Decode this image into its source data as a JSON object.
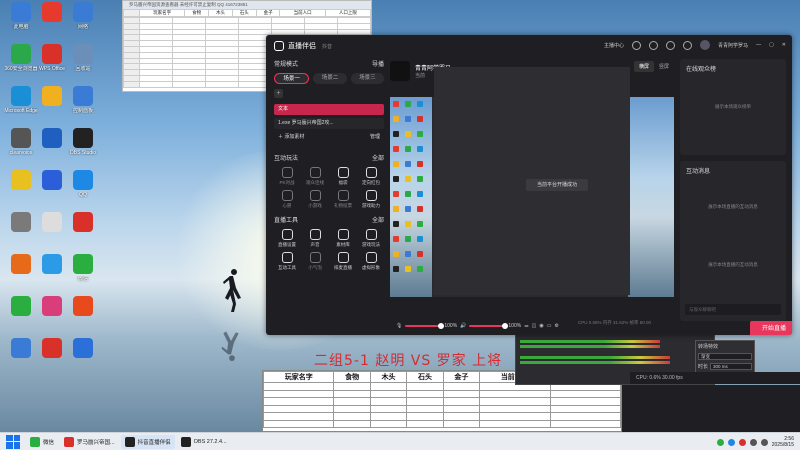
{
  "desktop": {
    "icons": [
      {
        "label": "此电脑",
        "color": "#3a7bd5"
      },
      {
        "label": "",
        "color": "#e63a2e"
      },
      {
        "label": "网络",
        "color": "#3a7bd5"
      },
      {
        "label": "360安全浏览器",
        "color": "#2aa84a"
      },
      {
        "label": "WPS Office",
        "color": "#d9302a"
      },
      {
        "label": "回收站",
        "color": "#6b8fb8"
      },
      {
        "label": "Microsoft Edge",
        "color": "#1b8fd6"
      },
      {
        "label": "",
        "color": "#f0b020"
      },
      {
        "label": "控制面板",
        "color": "#3a7bd5"
      },
      {
        "label": "clearvoice",
        "color": "#555"
      },
      {
        "label": "",
        "color": "#1f5fbf"
      },
      {
        "label": "OBS Studio",
        "color": "#222"
      },
      {
        "label": "",
        "color": "#e8c020"
      },
      {
        "label": "",
        "color": "#2b5fd9"
      },
      {
        "label": "QQ",
        "color": "#1e88e5"
      },
      {
        "label": "",
        "color": "#7a7a7a"
      },
      {
        "label": "",
        "color": "#ddd"
      },
      {
        "label": "",
        "color": "#d9302a"
      },
      {
        "label": "",
        "color": "#e66a1a"
      },
      {
        "label": "",
        "color": "#2b9be8"
      },
      {
        "label": "微信",
        "color": "#2aae3f"
      },
      {
        "label": "",
        "color": "#2aae3f"
      },
      {
        "label": "",
        "color": "#d93d7a"
      },
      {
        "label": "",
        "color": "#e8491d"
      },
      {
        "label": "",
        "color": "#3a7bd5"
      },
      {
        "label": "",
        "color": "#d9302a"
      },
      {
        "label": "",
        "color": "#2b6fd9"
      }
    ]
  },
  "small_sheet": {
    "title": "罗马蜃兴帝国资源查看器 未经许可禁止复制 QQ 416723881",
    "headers": [
      "玩家名字",
      "食物",
      "木头",
      "石头",
      "金子",
      "当前人口",
      "人口上限"
    ]
  },
  "big_sheet": {
    "headers": [
      "玩家名字",
      "食物",
      "木头",
      "石头",
      "金子",
      "当前人口",
      "人口上限"
    ]
  },
  "overlay_red_text": "二组5-1 赵明 VS 罗家 上将",
  "app": {
    "title": "直播伴侣",
    "subtitle": "抖音",
    "topbar": {
      "theme_center": "主播中心",
      "username": "青青阿学罗马"
    },
    "left": {
      "mode_label": "常规模式",
      "guide_label": "导播",
      "scenes": [
        "场景一",
        "场景二",
        "场景三"
      ],
      "sources": [
        {
          "label": "文本",
          "selected": true
        },
        {
          "label": "1.exe 罗马蜃兴帝国2攻...",
          "selected": false
        }
      ],
      "add_material": "添加素材",
      "manage": "管理",
      "interact_title": "互动玩法",
      "interact_more": "全部",
      "interact_tools": [
        {
          "label": "PK对战",
          "on": false
        },
        {
          "label": "观众连线",
          "on": false
        },
        {
          "label": "福袋",
          "on": true
        },
        {
          "label": "定向红包",
          "on": true
        },
        {
          "label": "心愿",
          "on": false
        },
        {
          "label": "小游戏",
          "on": false
        },
        {
          "label": "礼物投票",
          "on": false
        },
        {
          "label": "游戏助力",
          "on": true
        }
      ],
      "live_tools_title": "直播工具",
      "live_tools_more": "全部",
      "live_tools": [
        {
          "label": "直播设置",
          "on": true
        },
        {
          "label": "声音",
          "on": true
        },
        {
          "label": "素材库",
          "on": true
        },
        {
          "label": "游戏玩法",
          "on": true
        },
        {
          "label": "互动工具",
          "on": true
        },
        {
          "label": "小气泡",
          "on": false
        },
        {
          "label": "排麦直播",
          "on": true
        },
        {
          "label": "虚拟形象",
          "on": true
        }
      ]
    },
    "center": {
      "streamer_name": "青青阿学罗马",
      "streamer_sub": "当前",
      "mode_tabs": [
        "横屏",
        "竖屏"
      ],
      "toast": "当前平台开播成功",
      "mic_level": "100%",
      "speaker_level": "100%",
      "go_live": "开始直播",
      "status": "CPU 0.65%   内存 31.62%   帧率 60.00"
    },
    "right": {
      "viewers_title": "在线观众榜",
      "viewers_empty": "展示本场观众榜单",
      "activity_title": "互动消息",
      "activity_empty": "展示本场直播的互动消息",
      "chat_placeholder": "与观众聊聊吧"
    }
  },
  "obs": {
    "panel_title": "转场特效",
    "transition": "渐变",
    "duration_label": "时长",
    "duration": "300 ms",
    "status": "CPU: 0.6%  30.00 fps"
  },
  "taskbar": {
    "items": [
      {
        "label": "微信",
        "color": "#2aae3f",
        "active": false
      },
      {
        "label": "罗马蜃兴帝国...",
        "color": "#d9302a",
        "active": false
      },
      {
        "label": "抖音直播伴侣",
        "color": "#222",
        "active": true
      },
      {
        "label": "OBS 27.2.4...",
        "color": "#222",
        "active": false
      }
    ],
    "time": "2:56",
    "date": "2025/8/15"
  }
}
